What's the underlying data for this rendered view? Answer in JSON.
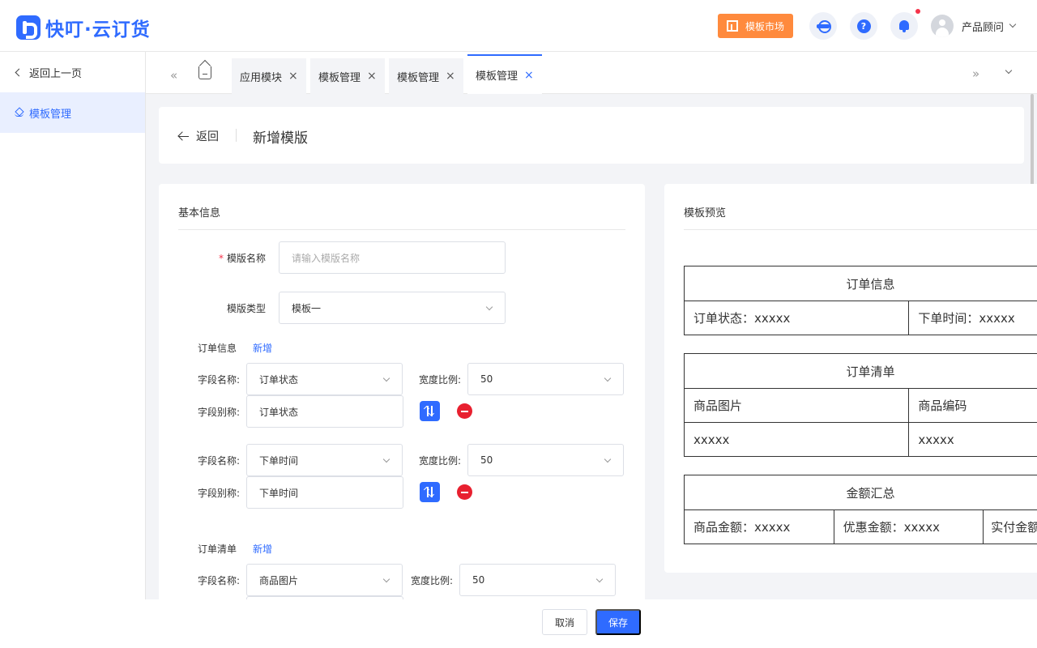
{
  "header": {
    "logo_text": "快叮·云订货",
    "market_label": "模板市场",
    "help_glyph": "?",
    "user_name": "产品顾问",
    "icons": {
      "service": "customer-service-icon",
      "help": "help-icon",
      "bell": "bell-icon"
    },
    "accent": "#2f6bff",
    "market_color": "#ff8a3d"
  },
  "sidebar": {
    "back_label": "返回上一页",
    "items": [
      {
        "label": "模板管理",
        "icon": "layers-icon",
        "active": true
      }
    ]
  },
  "tabs": {
    "items": [
      {
        "label": "应用模块",
        "close": "×"
      },
      {
        "label": "模板管理",
        "close": "×"
      },
      {
        "label": "模板管理",
        "close": "×"
      },
      {
        "label": "模板管理",
        "close": "×",
        "active": true
      }
    ],
    "prev_glyph": "«",
    "next_glyph": "»"
  },
  "page": {
    "back_label": "返回",
    "title": "新增模版"
  },
  "form": {
    "section_title": "基本信息",
    "template_name": {
      "label": "模版名称",
      "required_mark": "*",
      "placeholder": "请输入模版名称"
    },
    "template_type": {
      "label": "模版类型",
      "value": "模板一"
    },
    "order_info": {
      "label": "订单信息",
      "add_label": "新增",
      "fields": [
        {
          "name_label": "字段名称:",
          "name_value": "订单状态",
          "ratio_label": "宽度比例:",
          "ratio_value": "50",
          "alias_label": "字段别称:",
          "alias_value": "订单状态"
        },
        {
          "name_label": "字段名称:",
          "name_value": "下单时间",
          "ratio_label": "宽度比例:",
          "ratio_value": "50",
          "alias_label": "字段别称:",
          "alias_value": "下单时间"
        }
      ]
    },
    "order_list": {
      "label": "订单清单",
      "add_label": "新增",
      "fields": [
        {
          "name_label": "字段名称:",
          "name_value": "商品图片",
          "ratio_label": "宽度比例:",
          "ratio_value": "50"
        }
      ]
    }
  },
  "preview": {
    "title": "模板预览",
    "tables": [
      {
        "header": "订单信息",
        "rows": [
          [
            "订单状态：xxxxx",
            "下单时间：xxxxx"
          ]
        ]
      },
      {
        "header": "订单清单",
        "rows": [
          [
            "商品图片",
            "商品编码"
          ],
          [
            "xxxxx",
            "xxxxx"
          ]
        ]
      },
      {
        "header": "金额汇总",
        "rows": [
          [
            "商品金额：xxxxx",
            "优惠金额：xxxxx",
            "实付金额"
          ]
        ]
      }
    ]
  },
  "footer": {
    "cancel_label": "取消",
    "save_label": "保存"
  }
}
